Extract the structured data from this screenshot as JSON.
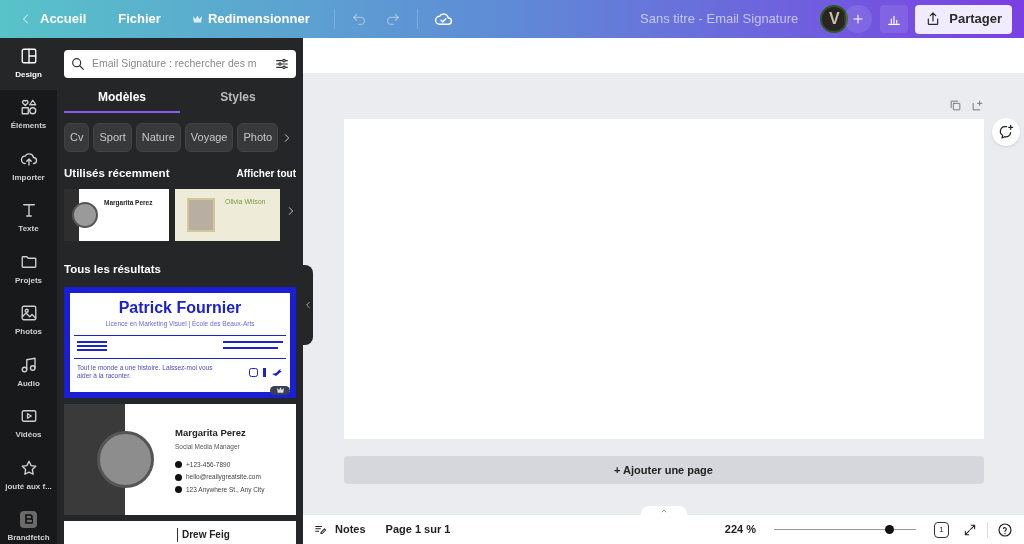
{
  "top_bar": {
    "back": "Accueil",
    "menu": "Fichier",
    "resize": "Redimensionner",
    "title": "Sans titre - Email Signature",
    "avatar": "V",
    "share": "Partager"
  },
  "rail": [
    {
      "kind": "design",
      "label": "Design",
      "selected": true
    },
    {
      "kind": "elements",
      "label": "Éléments",
      "selected": false
    },
    {
      "kind": "upload",
      "label": "Importer",
      "selected": false
    },
    {
      "kind": "text",
      "label": "Texte",
      "selected": false
    },
    {
      "kind": "folder",
      "label": "Projets",
      "selected": false
    },
    {
      "kind": "photo",
      "label": "Photos",
      "selected": false
    },
    {
      "kind": "audio",
      "label": "Audio",
      "selected": false
    },
    {
      "kind": "video",
      "label": "Vidéos",
      "selected": false
    },
    {
      "kind": "star",
      "label": "jouté aux f...",
      "selected": false
    },
    {
      "kind": "app",
      "label": "Brandfetch",
      "selected": false
    }
  ],
  "panel": {
    "search": {
      "placeholder": "Email Signature : rechercher des m"
    },
    "tabs": [
      {
        "label": "Modèles",
        "selected": true
      },
      {
        "label": "Styles",
        "selected": false
      }
    ],
    "chips": [
      "Cv",
      "Sport",
      "Nature",
      "Voyage",
      "Photo"
    ],
    "recent": {
      "title": "Utilisés récemment",
      "show_all": "Afficher tout",
      "templates": [
        {
          "kind": "portrait-round",
          "name": "Margarita Perez"
        },
        {
          "kind": "framed",
          "name": "Olivia Wilson"
        }
      ]
    },
    "results": {
      "title": "Tous les résultats",
      "patrick": {
        "name": "Patrick Fournier",
        "subtitle": "Licence en Marketing Visuel | École des Beaux-Arts",
        "tagline": "Tout le monde a une histoire. Laissez-moi vous aider à la raconter."
      },
      "margarita": {
        "name": "Margarita Perez",
        "role": "Social Media Manager",
        "contacts": [
          "+123-456-7890",
          "hello@reallygreatsite.com",
          "123 Anywhere St., Any City"
        ]
      },
      "third": {
        "name": "Drew Feig"
      }
    }
  },
  "canvas": {
    "add_page": "+ Ajouter une page"
  },
  "bottom_bar": {
    "notes": "Notes",
    "page": "Page 1 sur 1",
    "zoom": "224 %",
    "zoom_slider": {
      "level": 0.81
    },
    "page_count": "1"
  }
}
